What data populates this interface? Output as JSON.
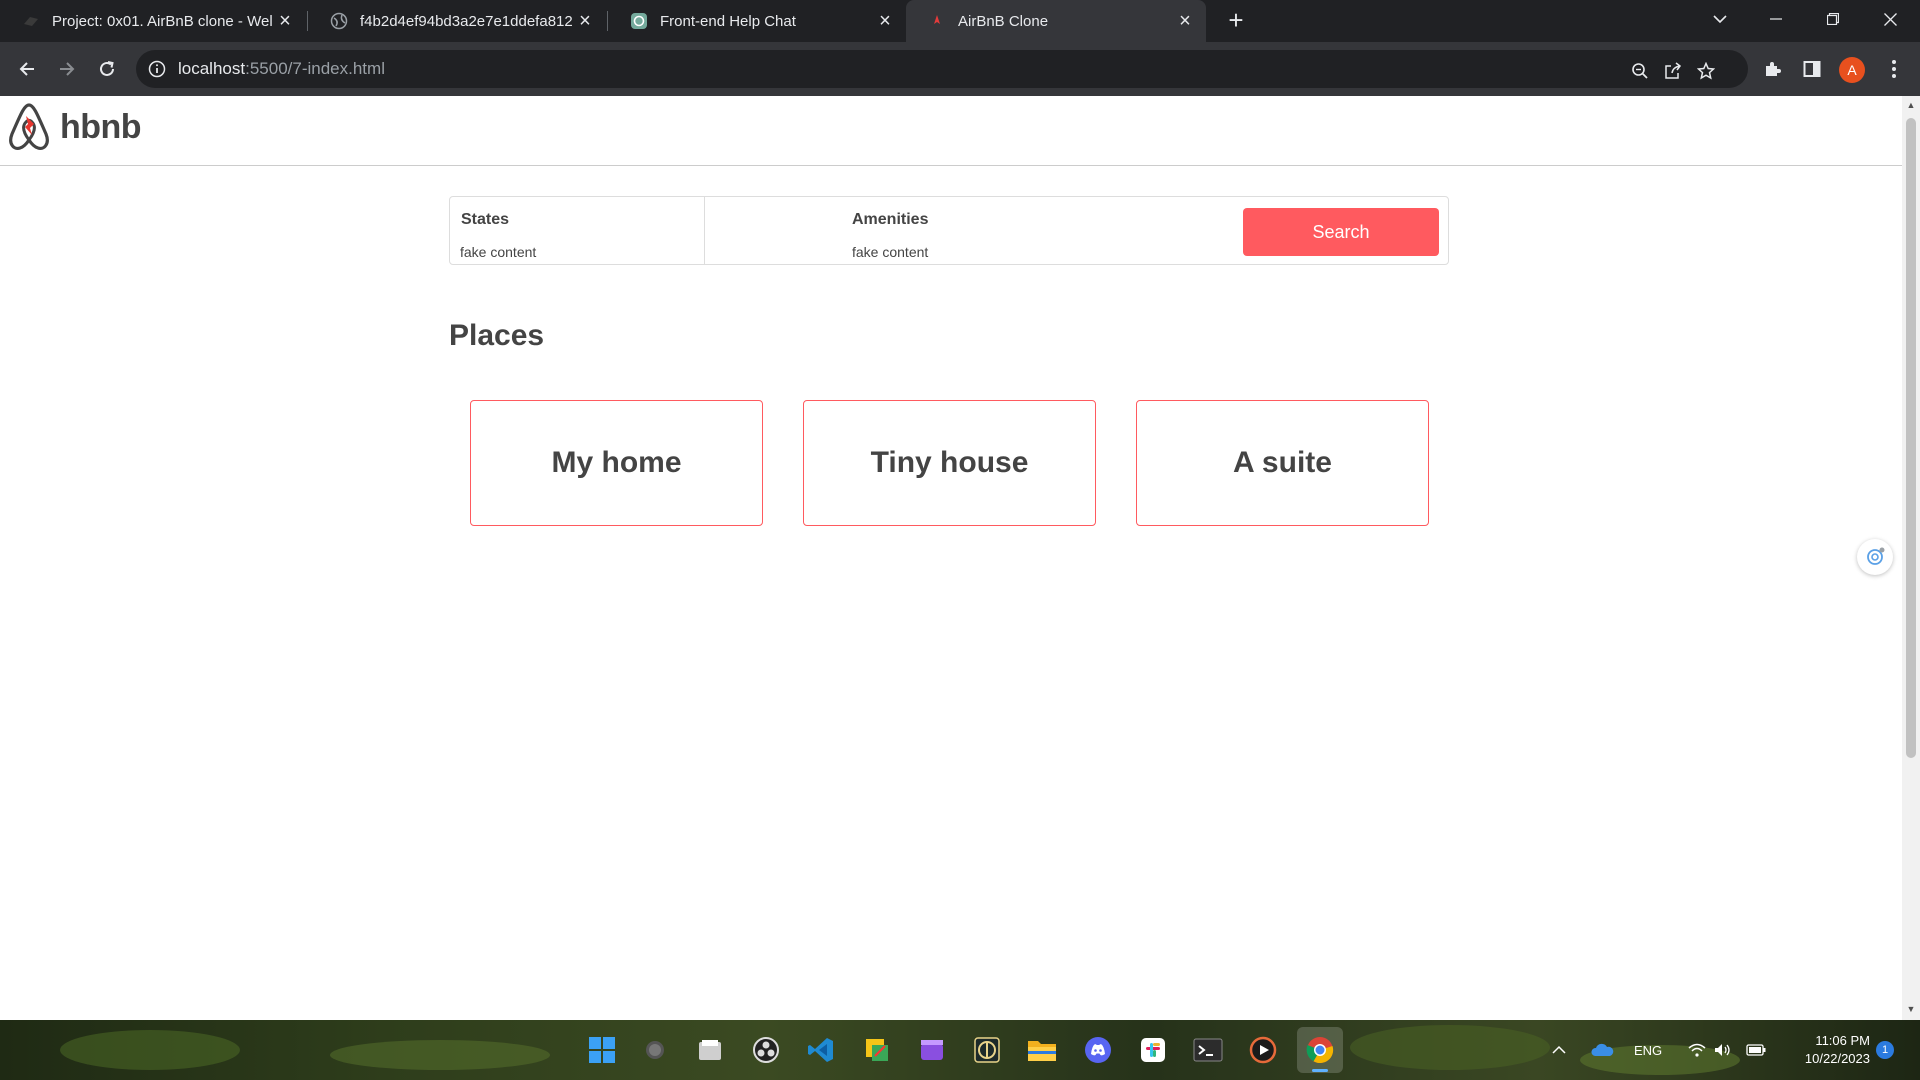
{
  "browser": {
    "tabs": [
      {
        "title": "Project: 0x01. AirBnB clone - Wel",
        "icon": "holberton-icon",
        "active": false
      },
      {
        "title": "f4b2d4ef94bd3a2e7e1ddefa812",
        "icon": "globe-icon",
        "active": false
      },
      {
        "title": "Front-end Help Chat",
        "icon": "chatgpt-icon",
        "active": false
      },
      {
        "title": "AirBnB Clone",
        "icon": "airbnb-favicon-icon",
        "active": true
      }
    ],
    "address": {
      "host": "localhost",
      "rest": ":5500/7-index.html"
    },
    "profile_initial": "A"
  },
  "site": {
    "brand": "hbnb",
    "accent_color": "#ff5a5f",
    "filters": {
      "states_label": "States",
      "states_value": "fake content",
      "amenities_label": "Amenities",
      "amenities_value": "fake content",
      "search_label": "Search"
    },
    "places_title": "Places",
    "places": [
      {
        "name": "My home"
      },
      {
        "name": "Tiny house"
      },
      {
        "name": "A suite"
      }
    ]
  },
  "taskbar": {
    "apps": [
      "windows-start-icon",
      "search-icon",
      "file-manager-icon",
      "obs-icon",
      "vscode-icon",
      "sticky-notes-icon",
      "clipchamp-icon",
      "trading-icon",
      "file-explorer-icon",
      "discord-icon",
      "slack-icon",
      "terminal-icon",
      "media-player-icon",
      "chrome-icon"
    ],
    "language": "ENG",
    "time": "11:06 PM",
    "date": "10/22/2023",
    "notifications": "1"
  }
}
